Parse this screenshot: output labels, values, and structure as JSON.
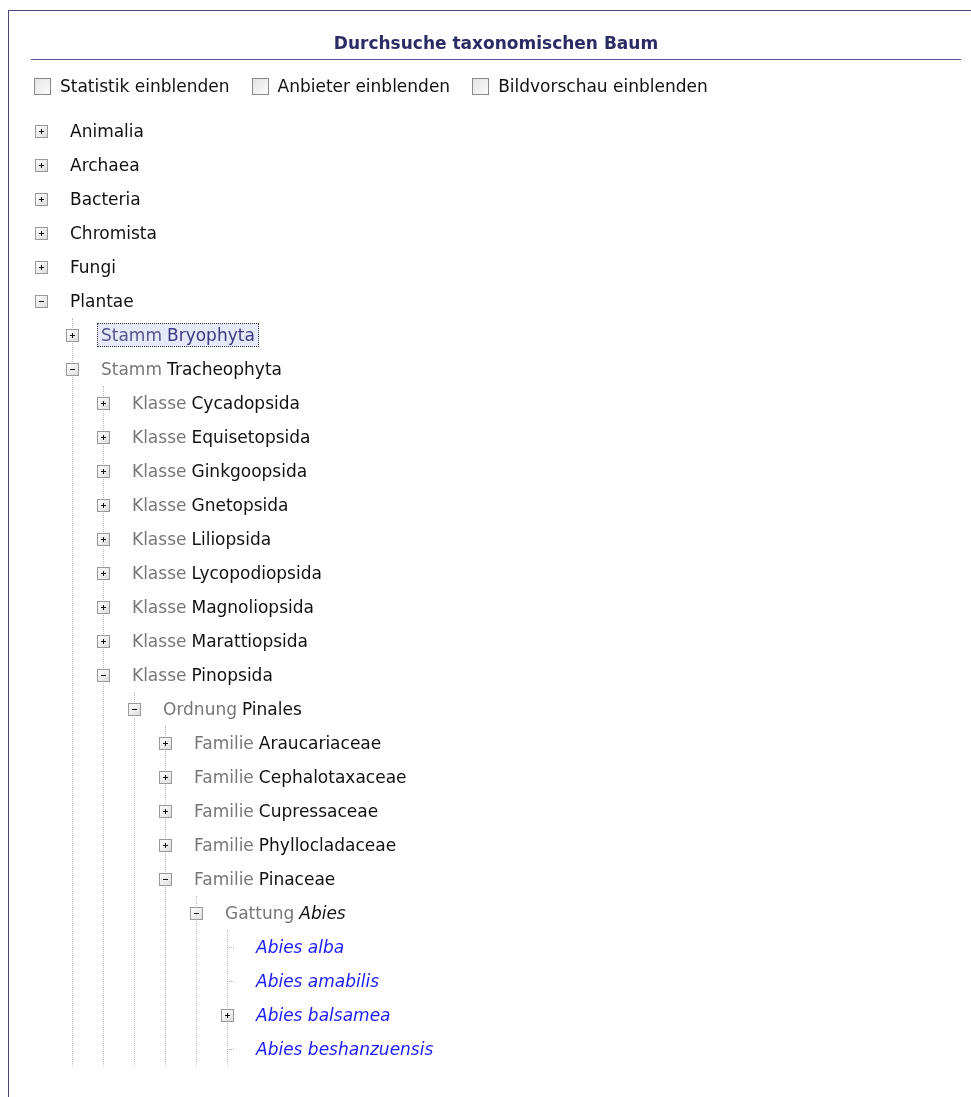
{
  "title": "Durchsuche taxonomischen Baum",
  "options": [
    {
      "label": "Statistik einblenden",
      "checked": false
    },
    {
      "label": "Anbieter einblenden",
      "checked": false
    },
    {
      "label": "Bildvorschau einblenden",
      "checked": false
    }
  ],
  "tree": [
    {
      "kind": "branch",
      "name": "Animalia",
      "expanded": false,
      "selected": false
    },
    {
      "kind": "branch",
      "name": "Archaea",
      "expanded": false,
      "selected": false
    },
    {
      "kind": "branch",
      "name": "Bacteria",
      "expanded": false,
      "selected": false
    },
    {
      "kind": "branch",
      "name": "Chromista",
      "expanded": false,
      "selected": false
    },
    {
      "kind": "branch",
      "name": "Fungi",
      "expanded": false,
      "selected": false
    },
    {
      "kind": "branch",
      "name": "Plantae",
      "expanded": true,
      "selected": false,
      "children": [
        {
          "kind": "branch",
          "rank": "Stamm",
          "name": "Bryophyta",
          "expanded": false,
          "selected": true
        },
        {
          "kind": "branch",
          "rank": "Stamm",
          "name": "Tracheophyta",
          "expanded": true,
          "selected": false,
          "children": [
            {
              "kind": "branch",
              "rank": "Klasse",
              "name": "Cycadopsida",
              "expanded": false,
              "selected": false
            },
            {
              "kind": "branch",
              "rank": "Klasse",
              "name": "Equisetopsida",
              "expanded": false,
              "selected": false
            },
            {
              "kind": "branch",
              "rank": "Klasse",
              "name": "Ginkgoopsida",
              "expanded": false,
              "selected": false
            },
            {
              "kind": "branch",
              "rank": "Klasse",
              "name": "Gnetopsida",
              "expanded": false,
              "selected": false
            },
            {
              "kind": "branch",
              "rank": "Klasse",
              "name": "Liliopsida",
              "expanded": false,
              "selected": false
            },
            {
              "kind": "branch",
              "rank": "Klasse",
              "name": "Lycopodiopsida",
              "expanded": false,
              "selected": false
            },
            {
              "kind": "branch",
              "rank": "Klasse",
              "name": "Magnoliopsida",
              "expanded": false,
              "selected": false
            },
            {
              "kind": "branch",
              "rank": "Klasse",
              "name": "Marattiopsida",
              "expanded": false,
              "selected": false
            },
            {
              "kind": "branch",
              "rank": "Klasse",
              "name": "Pinopsida",
              "expanded": true,
              "selected": false,
              "children": [
                {
                  "kind": "branch",
                  "rank": "Ordnung",
                  "name": "Pinales",
                  "expanded": true,
                  "selected": false,
                  "children": [
                    {
                      "kind": "branch",
                      "rank": "Familie",
                      "name": "Araucariaceae",
                      "expanded": false,
                      "selected": false
                    },
                    {
                      "kind": "branch",
                      "rank": "Familie",
                      "name": "Cephalotaxaceae",
                      "expanded": false,
                      "selected": false
                    },
                    {
                      "kind": "branch",
                      "rank": "Familie",
                      "name": "Cupressaceae",
                      "expanded": false,
                      "selected": false
                    },
                    {
                      "kind": "branch",
                      "rank": "Familie",
                      "name": "Phyllocladaceae",
                      "expanded": false,
                      "selected": false
                    },
                    {
                      "kind": "branch",
                      "rank": "Familie",
                      "name": "Pinaceae",
                      "expanded": true,
                      "selected": false,
                      "children": [
                        {
                          "kind": "branch",
                          "rank": "Gattung",
                          "name": "Abies",
                          "italic": true,
                          "expanded": true,
                          "selected": false,
                          "children": [
                            {
                              "kind": "species",
                              "name": "Abies alba",
                              "selected": false
                            },
                            {
                              "kind": "species",
                              "name": "Abies amabilis",
                              "selected": false
                            },
                            {
                              "kind": "species",
                              "name": "Abies balsamea",
                              "expanded": false,
                              "selected": false
                            },
                            {
                              "kind": "species",
                              "name": "Abies beshanzuensis",
                              "selected": false
                            }
                          ]
                        }
                      ]
                    }
                  ]
                }
              ]
            }
          ]
        }
      ]
    }
  ]
}
